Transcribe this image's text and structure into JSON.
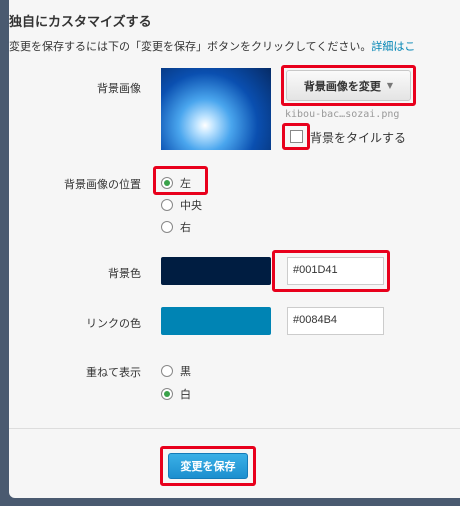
{
  "header": {
    "title": "独自にカスタマイズする",
    "description": "変更を保存するには下の「変更を保存」ボタンをクリックしてください。",
    "more_link": "詳細はこ"
  },
  "background_image": {
    "label": "背景画像",
    "change_button": "背景画像を変更",
    "caret": "▼",
    "filename": "kibou-bac…sozai.png",
    "tile_label": "背景をタイルする",
    "tile_checked": false
  },
  "position": {
    "label": "背景画像の位置",
    "options": [
      {
        "label": "左",
        "selected": true
      },
      {
        "label": "中央",
        "selected": false
      },
      {
        "label": "右",
        "selected": false
      }
    ]
  },
  "background_color": {
    "label": "背景色",
    "value": "#001D41",
    "swatch": "#001D41"
  },
  "link_color": {
    "label": "リンクの色",
    "value": "#0084B4",
    "swatch": "#0084B4"
  },
  "overlay": {
    "label": "重ねて表示",
    "options": [
      {
        "label": "黒",
        "selected": false
      },
      {
        "label": "白",
        "selected": true
      }
    ]
  },
  "save_button": "変更を保存",
  "highlight_color": "#e8001c"
}
